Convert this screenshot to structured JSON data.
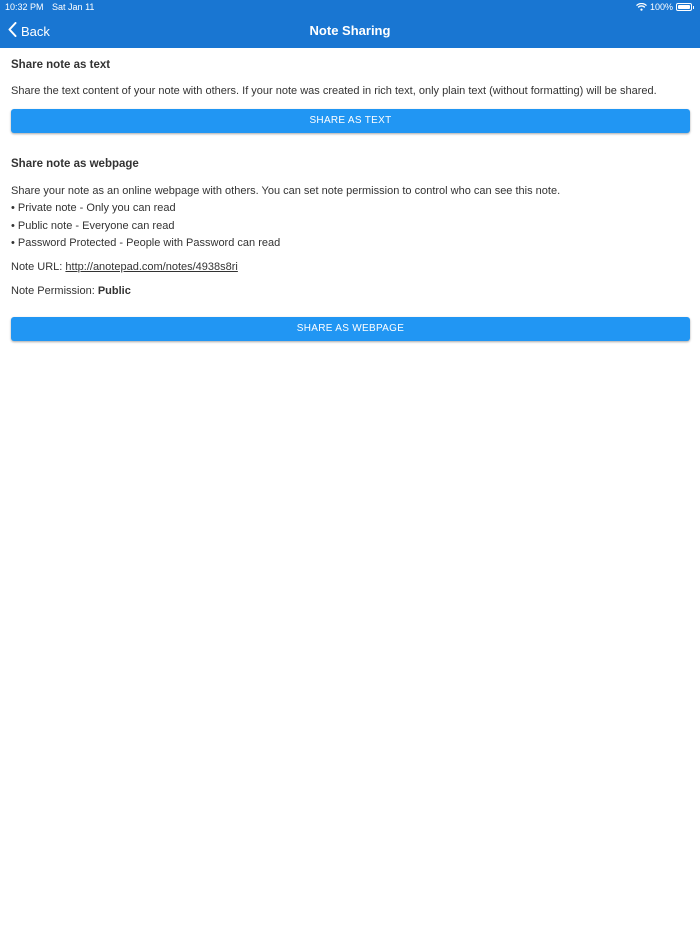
{
  "status_bar": {
    "time": "10:32 PM",
    "date": "Sat Jan 11",
    "battery": "100%"
  },
  "nav": {
    "back_label": "Back",
    "title": "Note Sharing"
  },
  "share_text": {
    "heading": "Share note as text",
    "description": "Share the text content of your note with others. If your note was created in rich text, only plain text (without formatting) will be shared.",
    "button_label": "SHARE AS TEXT"
  },
  "share_webpage": {
    "heading": "Share note as webpage",
    "description": "Share your note as an online webpage with others. You can set note permission to control who can see this note.",
    "bullets": [
      "• Private note - Only you can read",
      "• Public note - Everyone can read",
      "• Password Protected - People with Password can read"
    ],
    "url_label": "Note URL: ",
    "url": "http://anotepad.com/notes/4938s8ri",
    "permission_label": "Note Permission: ",
    "permission_value": "Public",
    "button_label": "SHARE AS WEBPAGE"
  },
  "colors": {
    "header": "#1976d2",
    "button": "#2196f3",
    "text": "#333333"
  }
}
